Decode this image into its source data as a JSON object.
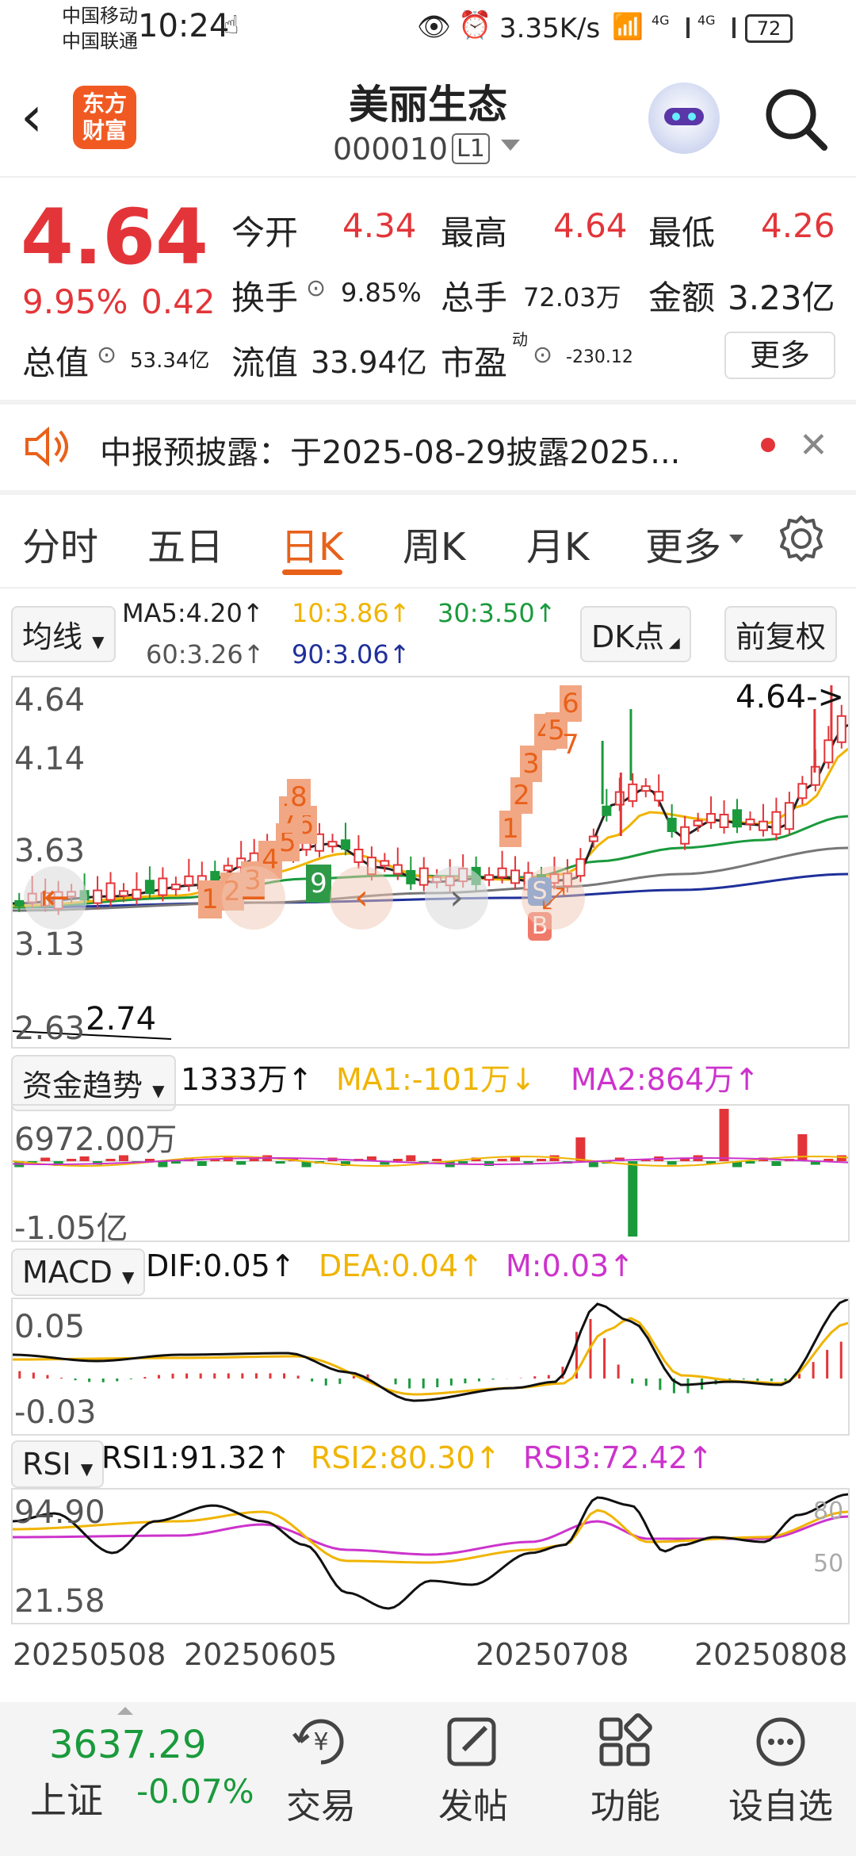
{
  "status_bar": {
    "carrier1": "中国移动",
    "carrier2": "中国联通",
    "time": "10:24",
    "net_speed": "3.35K/s",
    "signal1": "4G",
    "signal2": "4G",
    "battery": "72"
  },
  "header": {
    "brand": "东方\n财富",
    "title": "美丽生态",
    "code": "000010",
    "level": "L1"
  },
  "quote": {
    "price": "4.64",
    "change_pct": "9.95%",
    "change": "0.42",
    "open_label": "今开",
    "open": "4.34",
    "high_label": "最高",
    "high": "4.64",
    "low_label": "最低",
    "low": "4.26",
    "turnover_label": "换手",
    "turnover": "9.85%",
    "volume_label": "总手",
    "volume": "72.03万",
    "amount_label": "金额",
    "amount": "3.23亿",
    "mktcap_label": "总值",
    "mktcap": "53.34亿",
    "float_label": "流值",
    "float": "33.94亿",
    "pe_label": "市盈",
    "pe_sup": "动",
    "pe": "-230.12",
    "more": "更多"
  },
  "notice": {
    "text": "中报预披露：于2025-08-29披露2025..."
  },
  "tabs": [
    "分时",
    "五日",
    "日K",
    "周K",
    "月K",
    "更多"
  ],
  "ma": {
    "selector": "均线",
    "ma5": "MA5:4.20↑",
    "ma10": "10:3.86↑",
    "ma30": "30:3.50↑",
    "ma60": "60:3.26↑",
    "ma90": "90:3.06↑",
    "dk_button": "DK点",
    "adjust_button": "前复权"
  },
  "kline": {
    "y_labels": [
      "4.64",
      "4.14",
      "3.63",
      "3.13",
      "2.63"
    ],
    "last_label": "4.64->",
    "low_label": "2.74",
    "countdown_left": [
      "1",
      "2",
      "3",
      "4",
      "5",
      "6",
      "7",
      "8"
    ],
    "countdown_left_nine": "9",
    "countdown_right": [
      "1",
      "2",
      "3",
      "4",
      "5",
      "6",
      "7"
    ],
    "s_marker": "S",
    "b_marker": "B"
  },
  "fund": {
    "selector": "资金趋势",
    "value": "1333万↑",
    "ma1": "MA1:-101万↓",
    "ma2": "MA2:864万↑",
    "top_label": "6972.00万",
    "bottom_label": "-1.05亿"
  },
  "macd": {
    "selector": "MACD",
    "dif": "DIF:0.05↑",
    "dea": "DEA:0.04↑",
    "m": "M:0.03↑",
    "top_label": "0.05",
    "bottom_label": "-0.03"
  },
  "rsi": {
    "selector": "RSI",
    "rsi1": "RSI1:91.32↑",
    "rsi2": "RSI2:80.30↑",
    "rsi3": "RSI3:72.42↑",
    "top_label": "94.90",
    "bottom_label": "21.58",
    "ref80": "80",
    "ref50": "50"
  },
  "dates": [
    "20250508",
    "20250605",
    "20250708",
    "20250808"
  ],
  "bottom_bar": {
    "index_value": "3637.29",
    "index_name": "上证",
    "index_change": "-0.07%",
    "trade": "交易",
    "post": "发帖",
    "features": "功能",
    "watchlist": "设自选"
  },
  "colors": {
    "up": "#e33539",
    "down": "#1a9a3c",
    "accent": "#e8611a",
    "ma5": "#222222",
    "ma10": "#f0b400",
    "ma30": "#1a9a3c",
    "ma60": "#777777",
    "ma90": "#1f2f9a"
  }
}
